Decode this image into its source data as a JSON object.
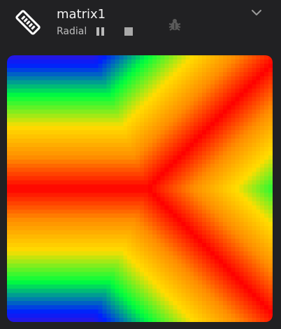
{
  "device": {
    "name": "matrix1",
    "pattern": "Radial",
    "icon": "led-strip-icon"
  },
  "controls": {
    "pause_icon": "pause-icon",
    "stop_icon": "stop-icon",
    "debug_icon": "bug-icon",
    "expand_icon": "chevron-down-icon"
  },
  "colors": {
    "background": "#212123",
    "title": "#f2f2f2",
    "subtitle": "#bdbdbd",
    "icon_dim": "#5a5a5a"
  }
}
